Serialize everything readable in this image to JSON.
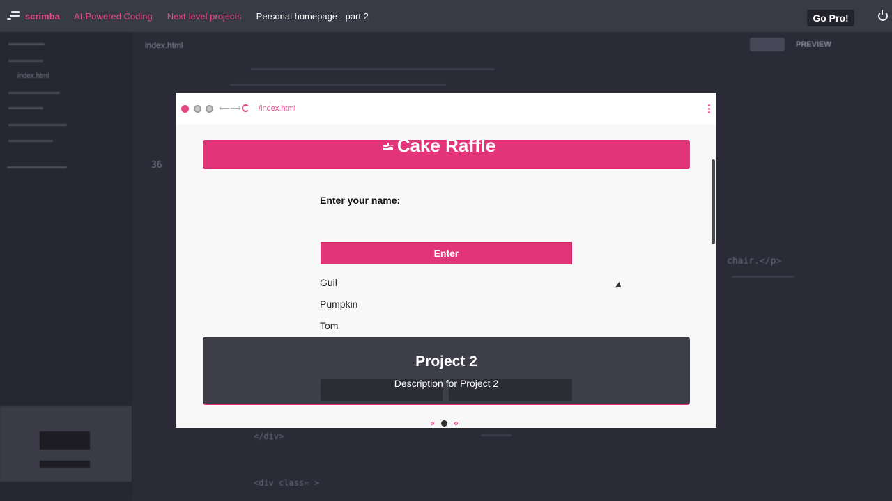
{
  "topbar": {
    "brand": "scrimba",
    "breadcrumbs": [
      "AI-Powered Coding",
      "Next-level projects",
      "Personal homepage - part 2"
    ],
    "cta": "Go Pro!"
  },
  "editor": {
    "file_tab": "index.html",
    "sidebar_file": "index.html",
    "preview_tab": "PREVIEW",
    "line_number": "36",
    "code_snippets": [
      "chair.</p>",
      "</div>",
      "<div class=      >"
    ]
  },
  "preview": {
    "url": "/index.html",
    "header_title": "Cake Raffle",
    "name_label": "Enter your name:",
    "enter_button": "Enter",
    "entrants": [
      "Guil",
      "Pumpkin",
      "Tom"
    ],
    "project": {
      "title": "Project 2",
      "description": "Description for Project 2"
    },
    "pager": {
      "total": 3,
      "active": 2
    }
  },
  "colors": {
    "accent": "#e23478",
    "topbar": "#383a46",
    "editor_bg": "#2a2b36",
    "card": "#3d3e48"
  },
  "icons": [
    "cake-icon",
    "reload-icon",
    "kebab-menu-icon",
    "power-icon",
    "scrimba-logo-icon"
  ]
}
